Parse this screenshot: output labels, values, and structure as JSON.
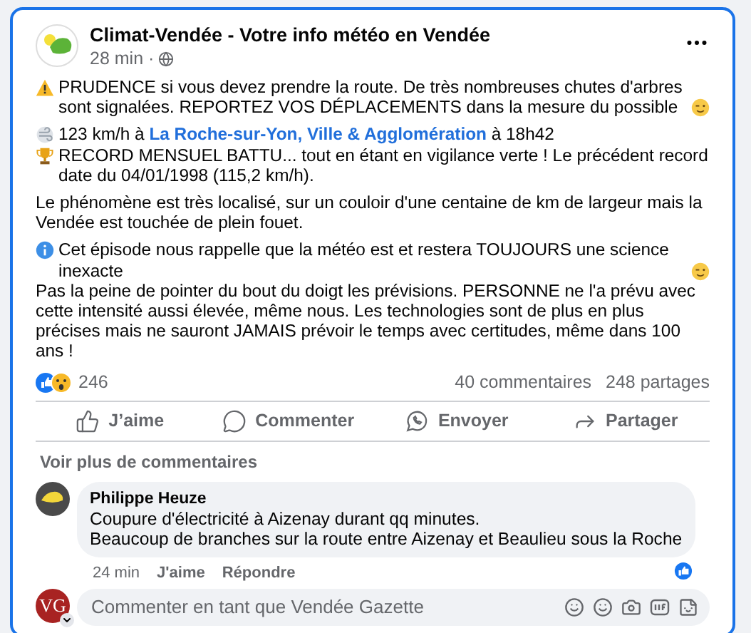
{
  "post": {
    "author": "Climat-Vendée - Votre info météo en Vendée",
    "time": "28 min ·",
    "blocks": [
      {
        "lines": [
          {
            "kind": "warning",
            "segments": [
              {
                "kind": "text",
                "text": "PRUDENCE si vous devez prendre la route. De très nombreuses chutes d'arbres sont signalées. REPORTEZ VOS DÉPLACEMENTS dans la mesure du possible"
              },
              {
                "kind": "wink"
              }
            ]
          }
        ]
      },
      {
        "lines": [
          {
            "kind": "wind",
            "segments": [
              {
                "kind": "text",
                "text": "123 km/h à"
              },
              {
                "kind": "link",
                "text": "La Roche-sur-Yon, Ville & Agglomération"
              },
              {
                "kind": "text",
                "text": "à 18h42"
              }
            ]
          },
          {
            "kind": "trophy",
            "segments": [
              {
                "kind": "text",
                "text": "RECORD MENSUEL BATTU... tout en étant en vigilance verte ! Le précédent record date du 04/01/1998 (115,2 km/h)."
              }
            ]
          }
        ]
      },
      {
        "lines": [
          {
            "kind": "plain",
            "segments": [
              {
                "kind": "text",
                "text": "Le phénomène est très localisé, sur un couloir d'une centaine de km de largeur mais la Vendée est touchée de plein fouet."
              }
            ]
          }
        ]
      },
      {
        "lines": [
          {
            "kind": "info",
            "segments": [
              {
                "kind": "text",
                "text": "Cet épisode nous rappelle que la météo est et restera TOUJOURS une science inexacte"
              },
              {
                "kind": "wink"
              }
            ]
          },
          {
            "kind": "plain",
            "segments": [
              {
                "kind": "text",
                "text": "Pas la peine de pointer du bout du doigt les prévisions. PERSONNE ne l'a prévu avec cette intensité aussi élevée, même nous. Les technologies sont de plus en plus précises mais ne sauront JAMAIS prévoir le temps avec certitudes, même dans 100 ans !"
              }
            ]
          }
        ]
      }
    ],
    "reaction_count": "246",
    "comments_count": "40 commentaires",
    "shares_count": "248 partages",
    "actions": [
      {
        "kind": "like",
        "label": "J’aime"
      },
      {
        "kind": "comment",
        "label": "Commenter"
      },
      {
        "kind": "send",
        "label": "Envoyer"
      },
      {
        "kind": "share",
        "label": "Partager"
      }
    ]
  },
  "more_comments": "Voir plus de commentaires",
  "comment": {
    "author": "Philippe Heuze",
    "lines": [
      "Coupure d'électricité à Aizenay durant qq minutes.",
      "Beaucoup de branches sur la route entre Aizenay et Beaulieu sous la Roche"
    ],
    "time": "24 min",
    "actions": [
      "J'aime",
      "Répondre"
    ],
    "liked": true
  },
  "composer": {
    "avatar_text": "VG",
    "placeholder": "Commenter en tant que Vendée Gazette"
  }
}
